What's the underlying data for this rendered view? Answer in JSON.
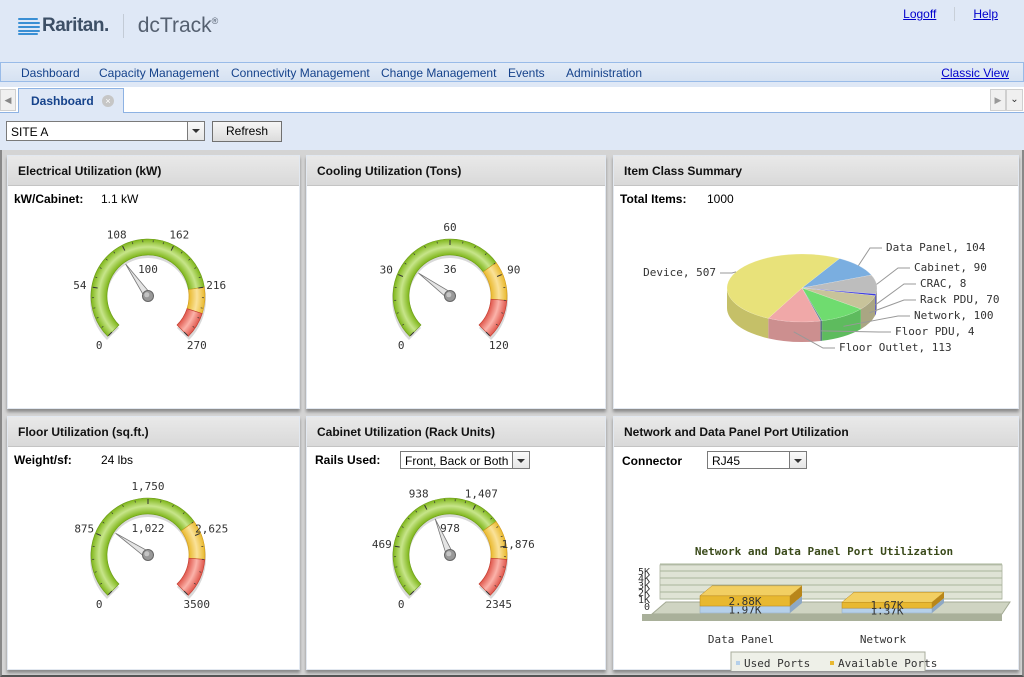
{
  "header": {
    "brand": "Raritan.",
    "product": "dcTrack",
    "product_mark": "®",
    "links": {
      "logoff": "Logoff",
      "help": "Help"
    }
  },
  "menu": {
    "items": [
      "Dashboard",
      "Capacity Management",
      "Connectivity Management",
      "Change Management",
      "Events",
      "Administration"
    ],
    "classic_view": "Classic View"
  },
  "tabs": {
    "active": "Dashboard",
    "scroll_left_icon": "◀",
    "scroll_right_icon": "▶",
    "menu_icon": "⌄",
    "close_icon": "×"
  },
  "toolbar": {
    "site_select": "SITE A",
    "refresh_label": "Refresh"
  },
  "panels": {
    "electrical": {
      "title": "Electrical Utilization (kW)",
      "label": "kW/Cabinet:",
      "value": "1.1 kW",
      "gauge": {
        "min": 0,
        "max": 270,
        "value": 100,
        "value_label": "100",
        "ticks": [
          "0",
          "54",
          "108",
          "162",
          "216",
          "270"
        ],
        "warn_from": 216,
        "danger_from": 243
      }
    },
    "cooling": {
      "title": "Cooling Utilization (Tons)",
      "gauge": {
        "min": 0,
        "max": 120,
        "value": 36,
        "value_label": "36",
        "ticks": [
          "0",
          "30",
          "60",
          "90",
          "120"
        ],
        "warn_from": 84,
        "danger_from": 102
      }
    },
    "item_class": {
      "title": "Item Class Summary",
      "label": "Total Items:",
      "value": "1000"
    },
    "floor": {
      "title": "Floor Utilization (sq.ft.)",
      "label": "Weight/sf:",
      "value": "24 lbs",
      "gauge": {
        "min": 0,
        "max": 3500,
        "value": 1022,
        "value_label": "1,022",
        "ticks": [
          "0",
          "875",
          "1,750",
          "2,625",
          "3500"
        ],
        "warn_from": 2450,
        "danger_from": 2975
      }
    },
    "cabinet": {
      "title": "Cabinet Utilization (Rack Units)",
      "label": "Rails Used:",
      "select": "Front, Back or Both",
      "gauge": {
        "min": 0,
        "max": 2345,
        "value": 978,
        "value_label": "978",
        "ticks": [
          "0",
          "469",
          "938",
          "1,407",
          "1,876",
          "2345"
        ],
        "warn_from": 1641,
        "danger_from": 1993
      }
    },
    "ports": {
      "title": "Network and Data Panel Port Utilization",
      "label": "Connector",
      "select": "RJ45"
    }
  },
  "chart_data": [
    {
      "type": "pie",
      "title": "Item Class Summary",
      "labels": [
        "Device",
        "Data Panel",
        "Cabinet",
        "CRAC",
        "Rack PDU",
        "Network",
        "Floor PDU",
        "Floor Outlet"
      ],
      "values": [
        507,
        104,
        90,
        8,
        70,
        100,
        4,
        113
      ],
      "colors": [
        "#e8e27a",
        "#7aaee0",
        "#bdbdbd",
        "#3a3adf",
        "#c8c39a",
        "#6fdc6f",
        "#6a8a9a",
        "#f0a8a8"
      ],
      "data_labels": [
        "Device, 507",
        "Data Panel, 104",
        "Cabinet, 90",
        "CRAC, 8",
        "Rack PDU, 70",
        "Network, 100",
        "Floor PDU, 4",
        "Floor Outlet, 113"
      ]
    },
    {
      "type": "bar",
      "stacked": true,
      "title": "Network and Data Panel Port Utilization",
      "categories": [
        "Data Panel",
        "Network"
      ],
      "series": [
        {
          "name": "Used Ports",
          "values": [
            1970,
            1370
          ],
          "labels": [
            "1.97K",
            "1.37K"
          ],
          "color": "#b5d0ea"
        },
        {
          "name": "Available Ports",
          "values": [
            2880,
            1670
          ],
          "labels": [
            "2.88K",
            "1.67K"
          ],
          "color": "#e8b830"
        }
      ],
      "y_ticks": [
        "0",
        "1K",
        "2K",
        "3K",
        "4K",
        "5K"
      ],
      "ylim": [
        0,
        5000
      ],
      "legend": "bottom"
    }
  ]
}
